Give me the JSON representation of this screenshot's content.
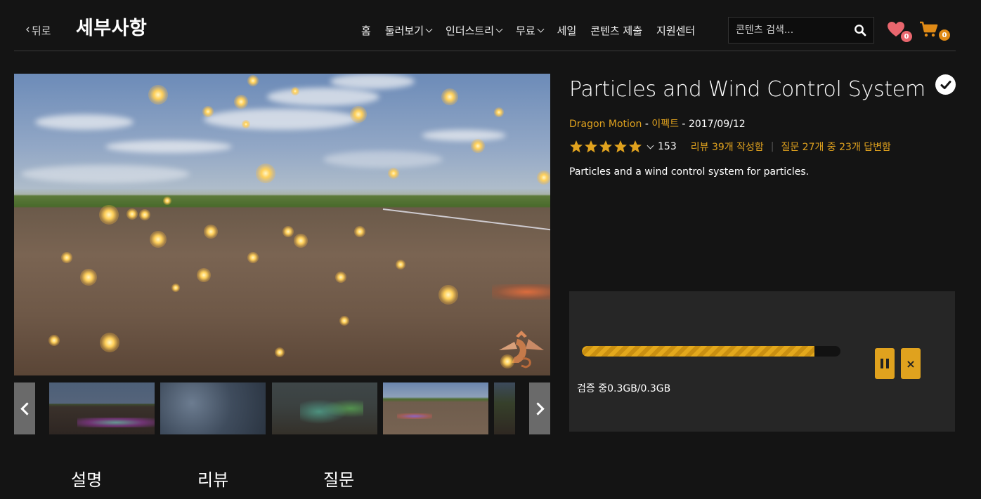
{
  "header": {
    "back_label": "뒤로",
    "title": "세부사항",
    "nav": [
      "홈",
      "둘러보기",
      "인더스트리",
      "무료",
      "세일",
      "콘텐츠 제출",
      "지원센터"
    ],
    "nav_dropdown": [
      false,
      true,
      true,
      true,
      false,
      false,
      false
    ],
    "search_placeholder": "콘텐츠 검색...",
    "wishlist_count": "0",
    "cart_count": "0"
  },
  "product": {
    "title": "Particles and Wind Control System",
    "publisher": "Dragon Motion",
    "category": "이펙트",
    "date": "2017/09/12",
    "rating_stars": 5,
    "rating_count": "153",
    "reviews_text": "리뷰 39개 작성함",
    "questions_text": "질문 27개 중 23개 답변함",
    "description": "Particles and a wind control system for particles.",
    "owned": true
  },
  "download": {
    "progress": 0.9,
    "status": "검증 중0.3GB/0.3GB"
  },
  "tabs": [
    "설명",
    "리뷰",
    "질문"
  ],
  "colors": {
    "accent": "#e0a21e",
    "background": "#141414",
    "panel": "#262626",
    "wishlist_badge": "#e9666e",
    "cart_badge": "#e08a16"
  }
}
